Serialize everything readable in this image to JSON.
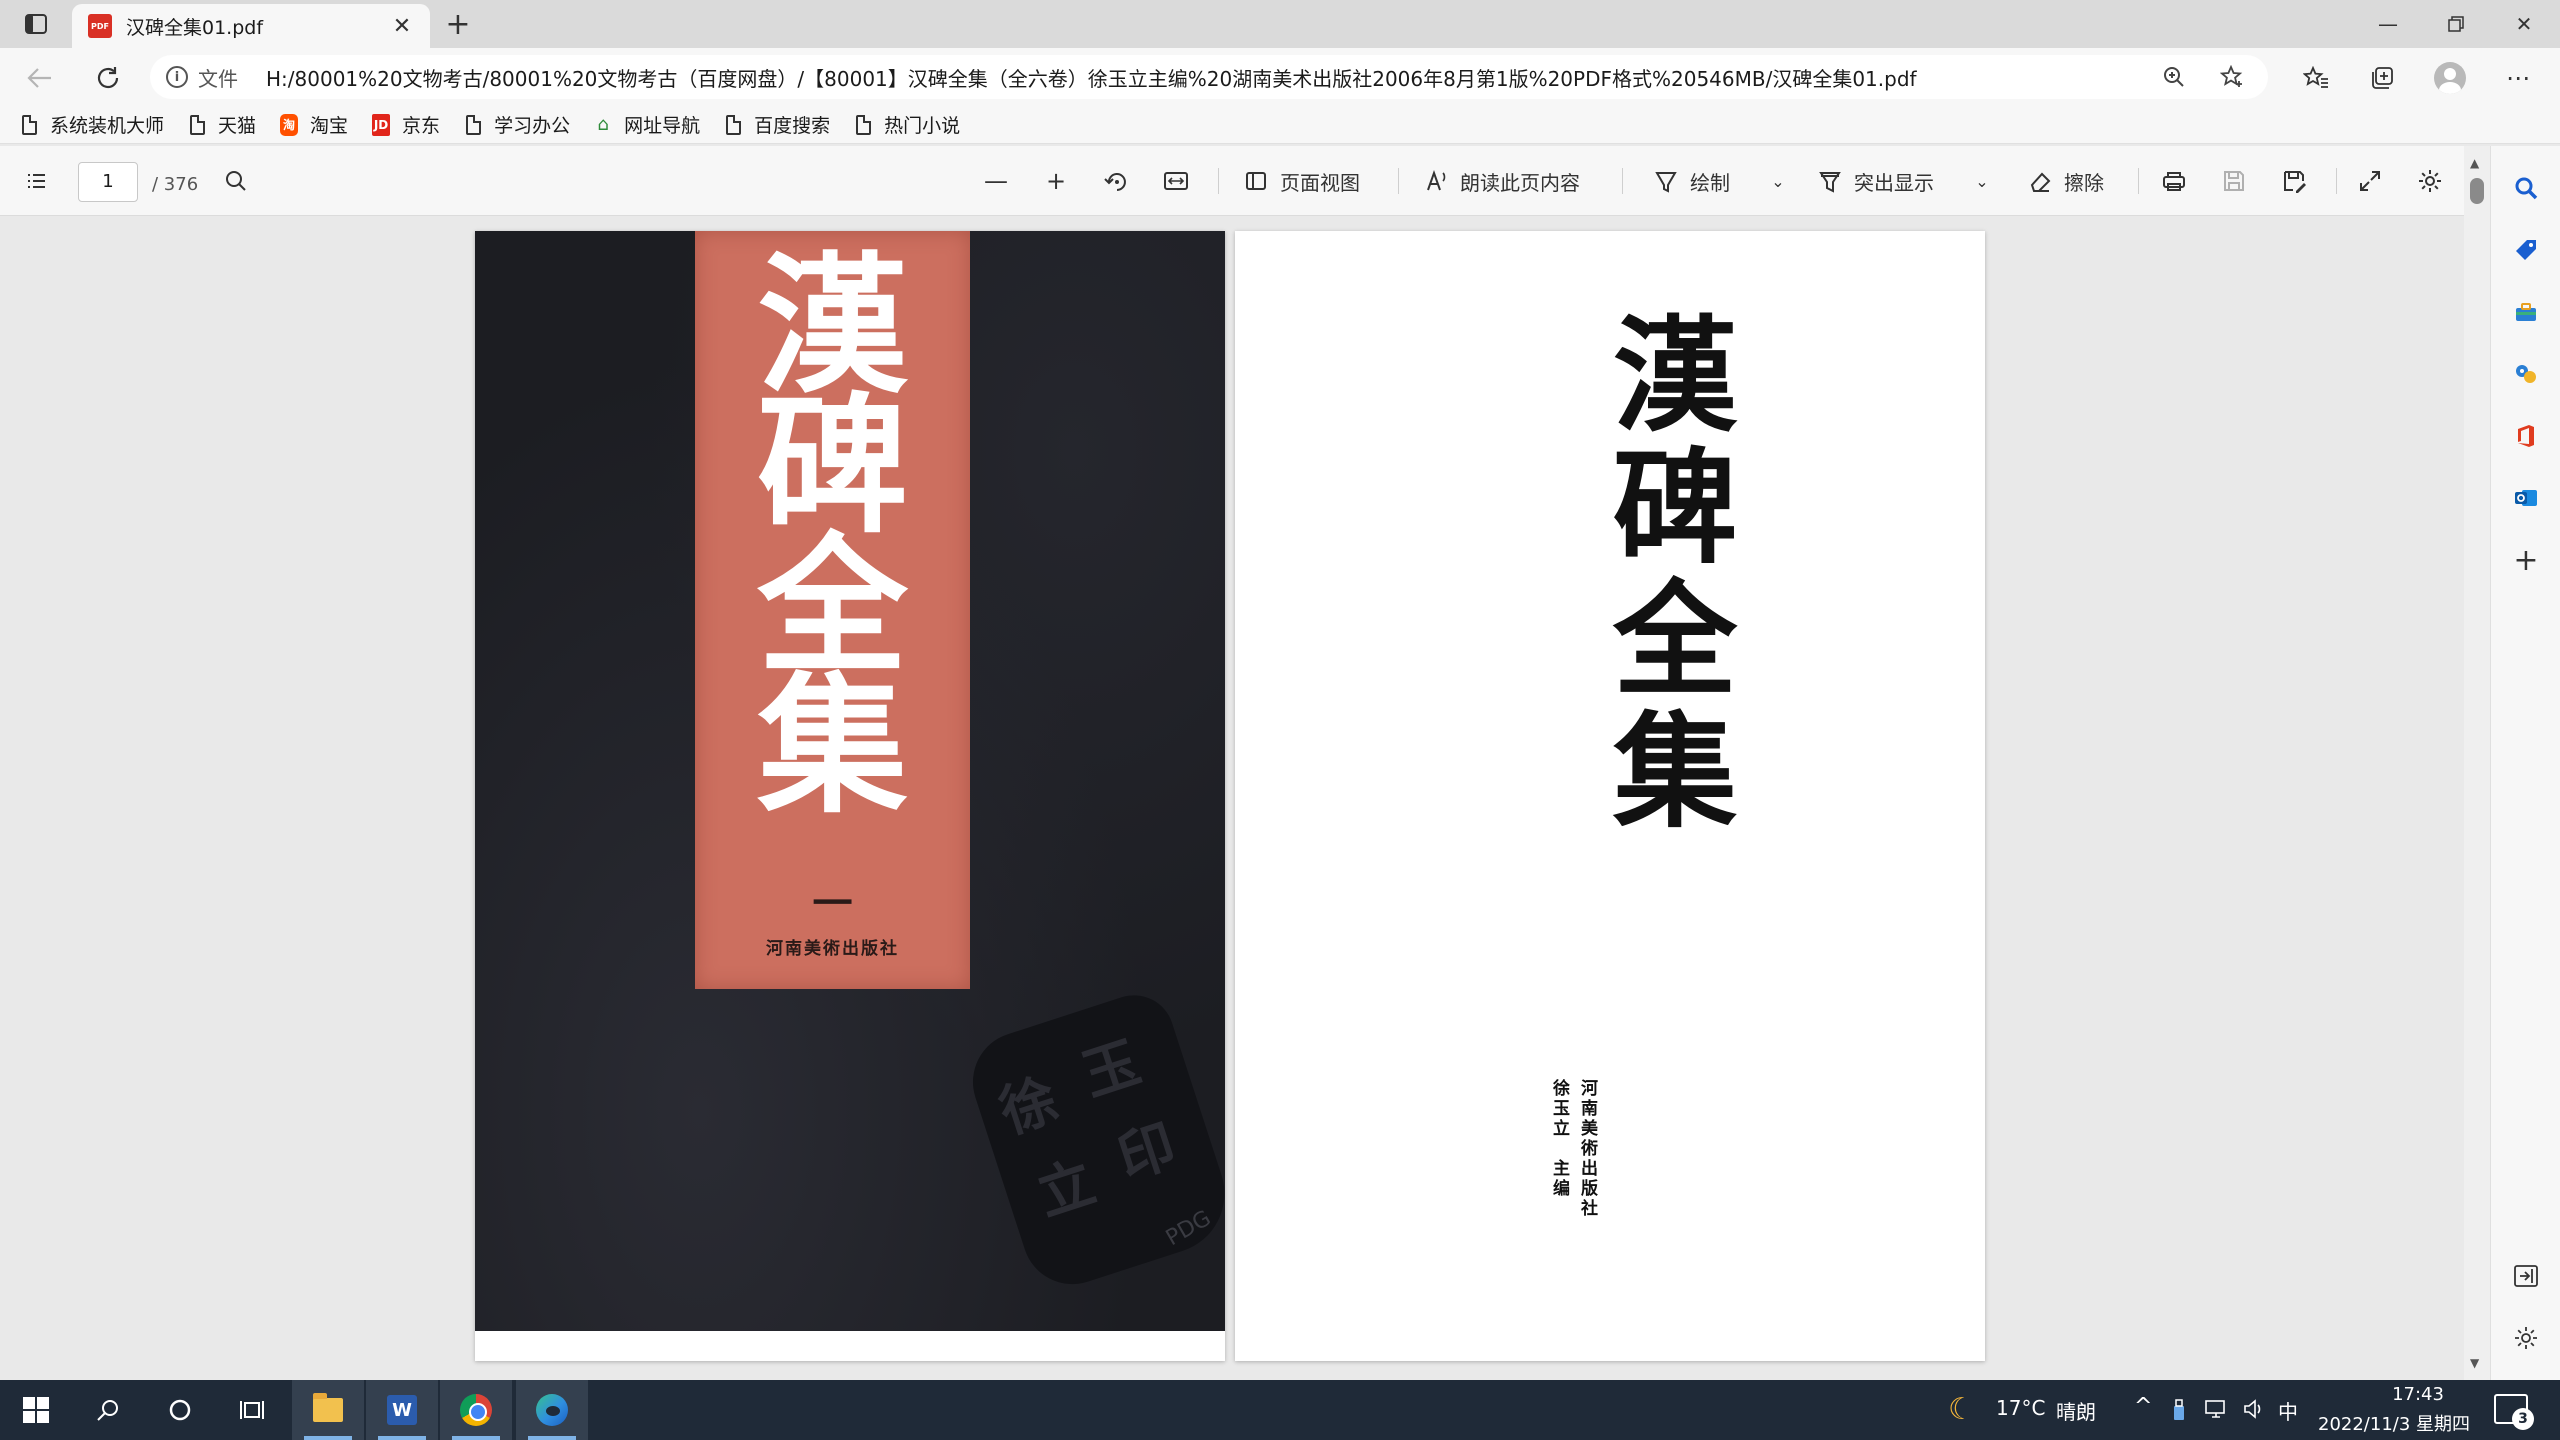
{
  "tab": {
    "title": "汉碑全集01.pdf",
    "badge": "PDF"
  },
  "address": {
    "file_label": "文件",
    "url": "H:/80001%20文物考古/80001%20文物考古（百度网盘）/【80001】汉碑全集（全六卷）徐玉立主编%20湖南美术出版社2006年8月第1版%20PDF格式%20546MB/汉碑全集01.pdf"
  },
  "favorites": [
    {
      "label": "系统装机大师",
      "icon": "document-icon"
    },
    {
      "label": "天猫",
      "icon": "document-icon"
    },
    {
      "label": "淘宝",
      "icon": "taobao-icon"
    },
    {
      "label": "京东",
      "icon": "jd-icon"
    },
    {
      "label": "学习办公",
      "icon": "document-icon"
    },
    {
      "label": "网址导航",
      "icon": "web-nav-icon"
    },
    {
      "label": "百度搜索",
      "icon": "document-icon"
    },
    {
      "label": "热门小说",
      "icon": "document-icon"
    }
  ],
  "pdf_toolbar": {
    "current_page": "1",
    "total_pages": "/ 376",
    "page_view_label": "页面视图",
    "read_aloud_label": "朗读此页内容",
    "draw_label": "绘制",
    "highlight_label": "突出显示",
    "erase_label": "擦除"
  },
  "cover": {
    "title_chars": [
      "漢",
      "碑",
      "全",
      "集"
    ],
    "volume": "一",
    "publisher": "河南美術出版社",
    "seal_chars": [
      "徐",
      "玉",
      "立",
      "印"
    ],
    "watermark": "PDG"
  },
  "title_page": {
    "title_chars": [
      "漢",
      "碑",
      "全",
      "集"
    ],
    "editor": "徐玉立　主编",
    "publisher": "河南美術出版社"
  },
  "taskbar": {
    "weather_temp": "17°C",
    "weather_desc": "晴朗",
    "ime": "中",
    "time": "17:43",
    "date": "2022/11/3 星期四",
    "notification_count": "3",
    "word_letter": "W"
  },
  "colors": {
    "cover_bg": "#1c1d22",
    "cover_strip": "#cc6f5f",
    "taskbar_bg": "#1f2a38",
    "chrome_bg": "#f7f7f7"
  }
}
